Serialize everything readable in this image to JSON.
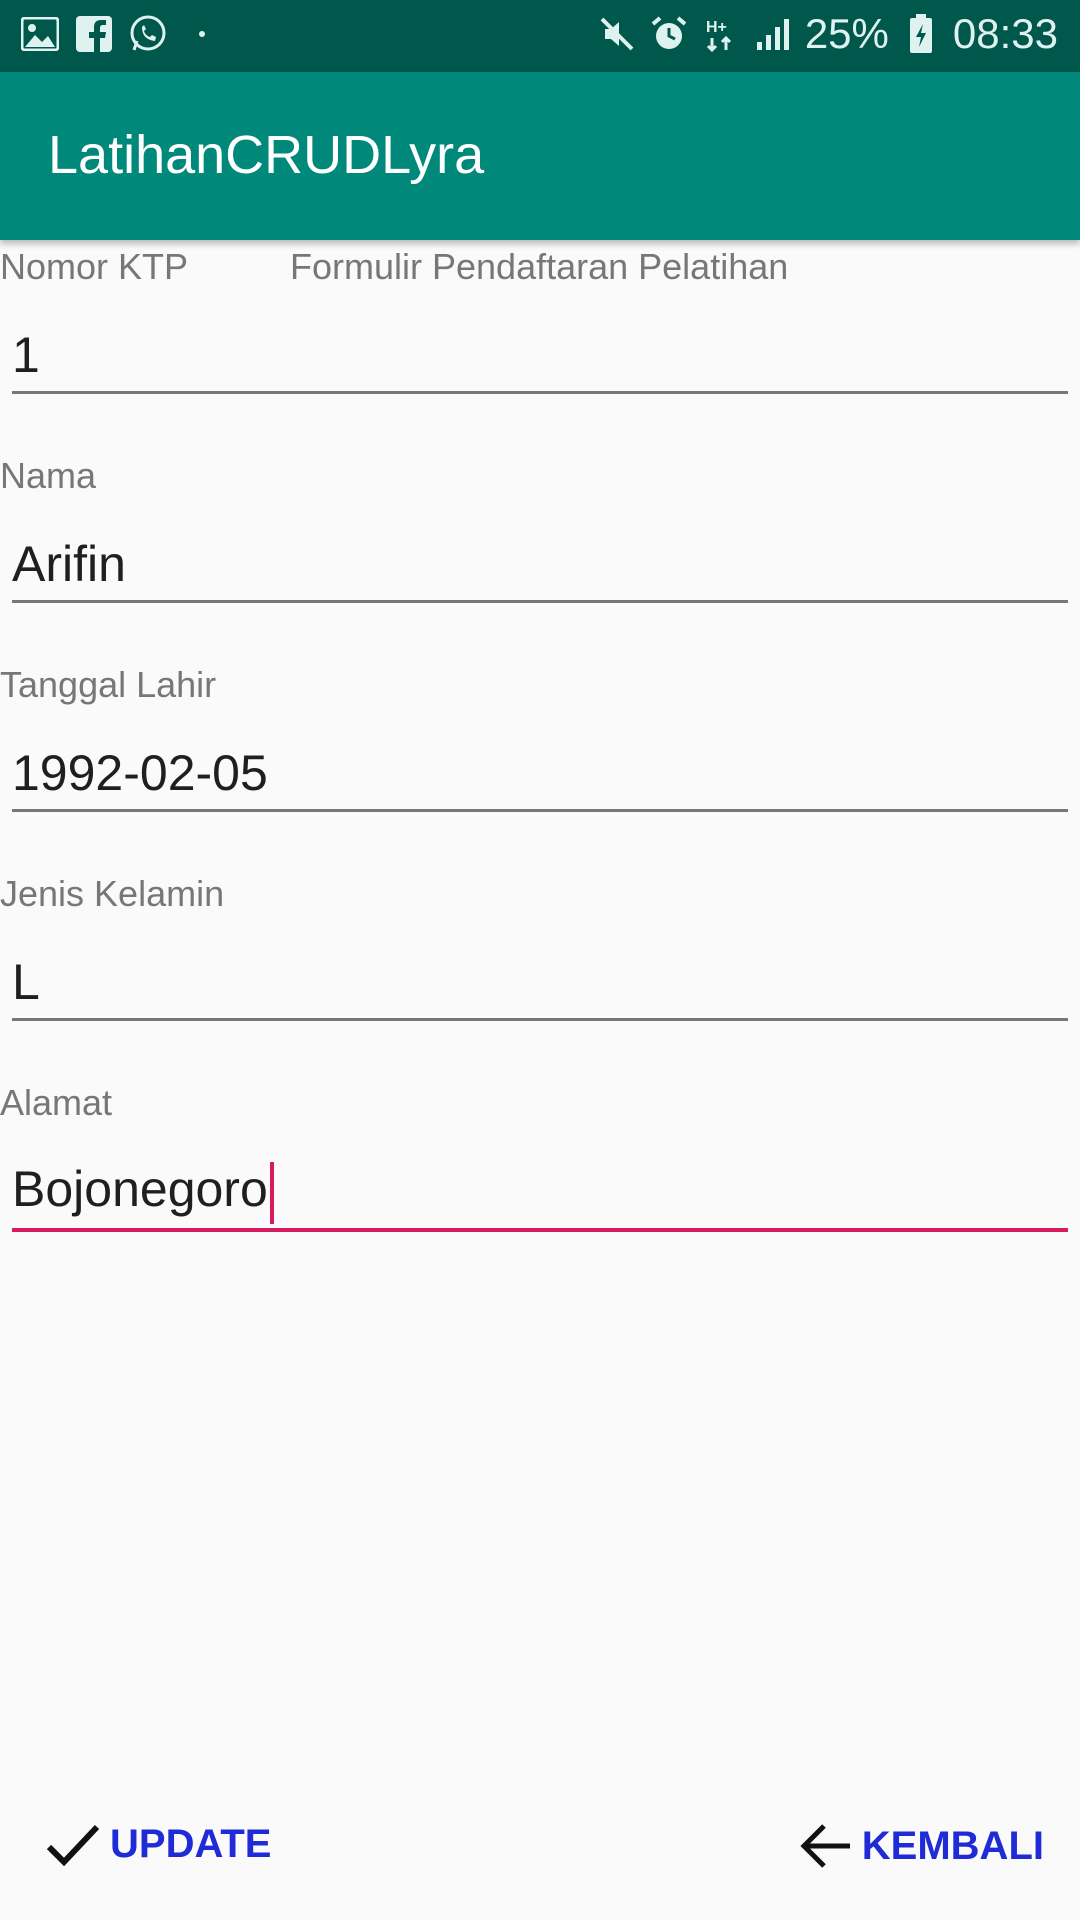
{
  "status_bar": {
    "battery": "25%",
    "time": "08:33",
    "icons_left": [
      "image-icon",
      "facebook-icon",
      "whatsapp-icon",
      "dot-icon"
    ],
    "icons_right": [
      "mute-icon",
      "alarm-icon",
      "data-icon",
      "signal-icon",
      "battery-icon"
    ]
  },
  "app_bar": {
    "title": "LatihanCRUDLyra",
    "color": "#00897b"
  },
  "form": {
    "title": "Formulir Pendaftaran Pelatihan",
    "fields": [
      {
        "label": "Nomor KTP",
        "value": "1"
      },
      {
        "label": "Nama",
        "value": "Arifin"
      },
      {
        "label": "Tanggal Lahir",
        "value": "1992-02-05"
      },
      {
        "label": "Jenis Kelamin",
        "value": "L"
      },
      {
        "label": "Alamat",
        "value": "Bojonegoro"
      }
    ]
  },
  "actions": {
    "update_label": "UPDATE",
    "back_label": "KEMBALI",
    "accent": "#1f2bd6"
  }
}
